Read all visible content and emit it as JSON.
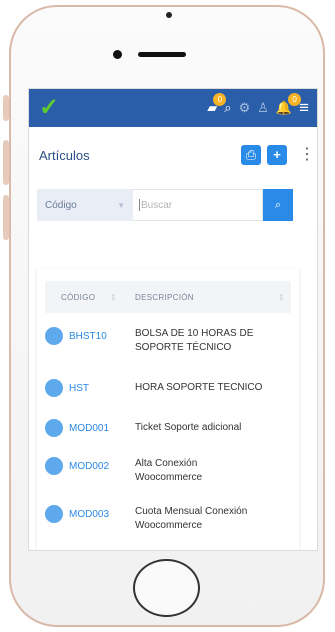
{
  "app": {
    "logo_glyph": "✓",
    "accent": "#2a8ae7",
    "topbar_color": "#2b5ea8",
    "logo_color": "#5ccb2f"
  },
  "topbar": {
    "icons": [
      {
        "name": "chat-icon",
        "glyph": "▰",
        "badge": "0"
      },
      {
        "name": "search-icon",
        "glyph": "⌕"
      },
      {
        "name": "settings-icon",
        "glyph": "⚙"
      },
      {
        "name": "user-icon",
        "glyph": "♙"
      },
      {
        "name": "notifications-icon",
        "glyph": "🔔",
        "badge": "0"
      },
      {
        "name": "menu-icon",
        "glyph": "≡"
      }
    ]
  },
  "page": {
    "title": "Artículos",
    "print_glyph": "⎙",
    "add_glyph": "+",
    "more_glyph": "⋮"
  },
  "filter": {
    "select_value": "Código",
    "search_placeholder": "Buscar",
    "search_glyph": "⌕"
  },
  "table": {
    "columns": [
      "CÓDIGO",
      "DESCRIPCIÓN"
    ],
    "rows": [
      {
        "code": "BHST10",
        "description": "BOLSA DE 10 HORAS DE SOPORTE TÉCNICO"
      },
      {
        "code": "HST",
        "description": "HORA SOPORTE TECNICO"
      },
      {
        "code": "MOD001",
        "description": "Ticket Soporte adicional"
      },
      {
        "code": "MOD002",
        "description": "Alta Conexión Woocommerce"
      },
      {
        "code": "MOD003",
        "description": "Cuota Mensual Conexión Woocommerce"
      }
    ]
  }
}
